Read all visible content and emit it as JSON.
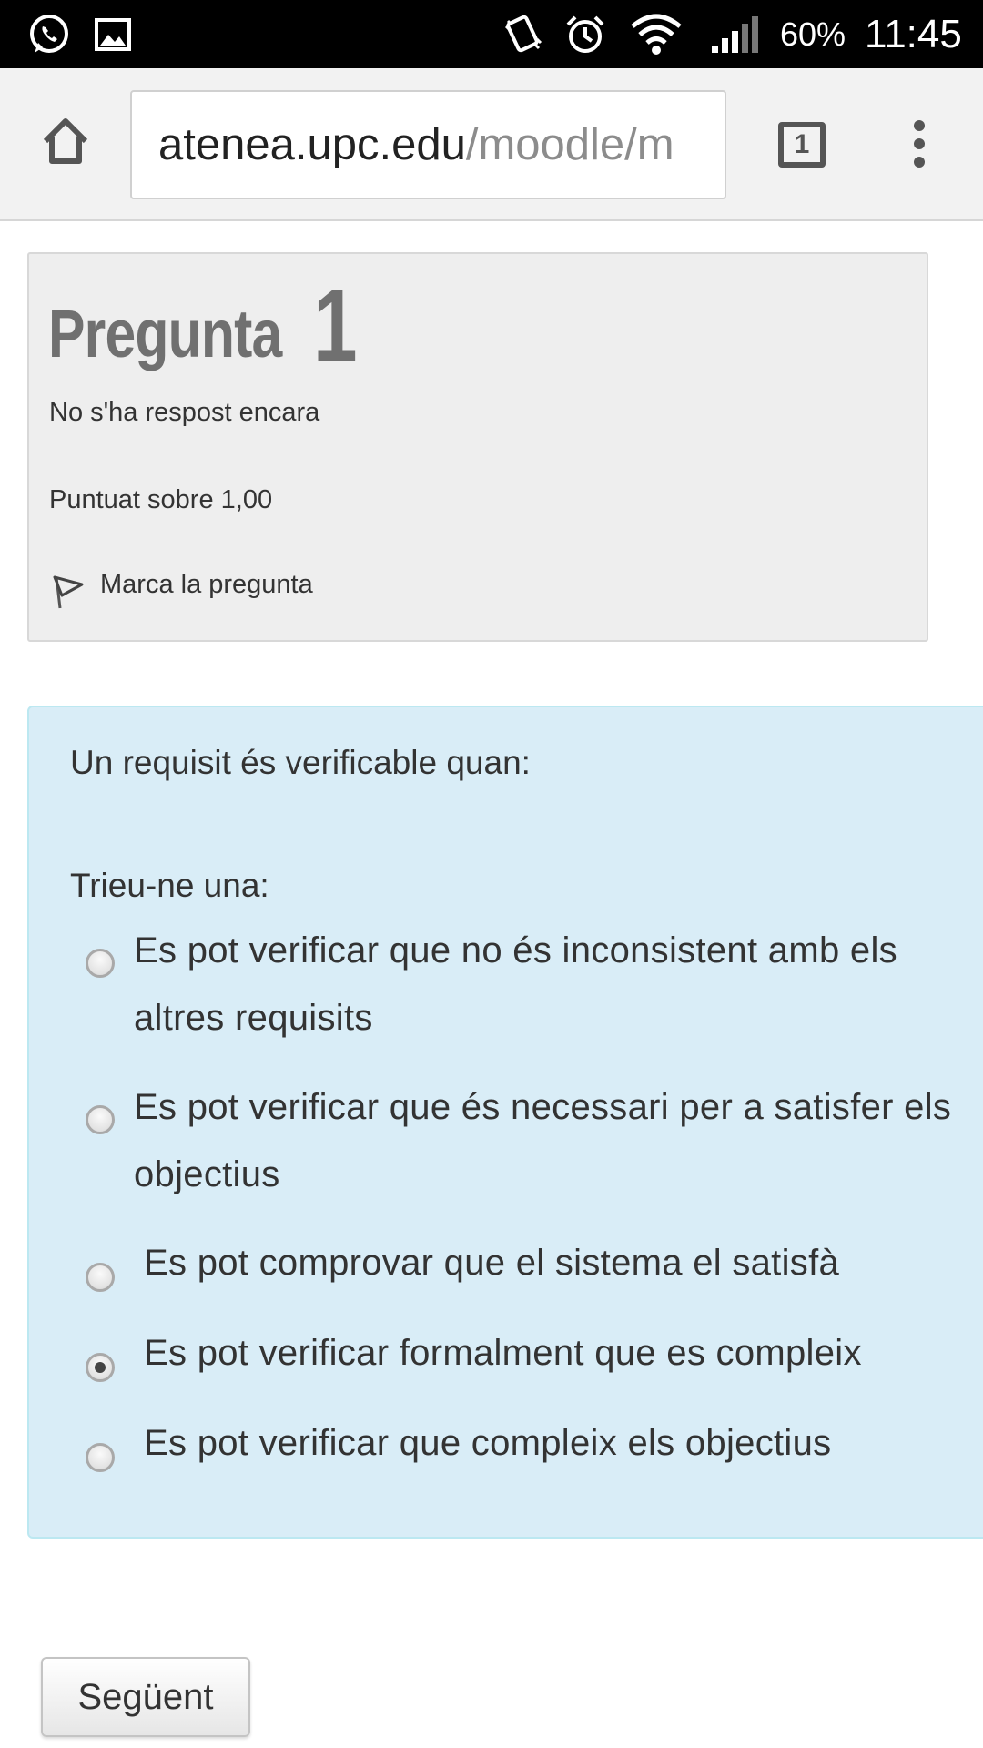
{
  "status_bar": {
    "battery": "60%",
    "time": "11:45",
    "icons": [
      "whatsapp-icon",
      "gallery-icon",
      "vibrate-icon",
      "alarm-icon",
      "wifi-icon",
      "signal-icon"
    ]
  },
  "browser": {
    "url_host": "atenea.upc.edu",
    "url_path": "/moodle/m",
    "tab_count": "1",
    "icons": [
      "home-icon",
      "overflow-menu-icon"
    ]
  },
  "question_info": {
    "title_word": "Pregunta",
    "number": "1",
    "state": "No s'ha respost encara",
    "mark": "Puntuat sobre 1,00",
    "flag_label": "Marca la pregunta"
  },
  "question": {
    "prompt": "Un requisit és verificable quan:",
    "instruction": "Trieu-ne una:",
    "options": [
      {
        "label": "Es pot verificar que no és inconsistent amb els altres requisits",
        "selected": false
      },
      {
        "label": "Es pot verificar que és necessari per a satisfer els objectius",
        "selected": false
      },
      {
        "label": "Es pot comprovar que el sistema el satisfà",
        "selected": false
      },
      {
        "label": "Es pot verificar formalment que es compleix",
        "selected": true
      },
      {
        "label": "Es pot verificar que compleix els objectius",
        "selected": false
      }
    ]
  },
  "navigation": {
    "next_label": "Següent"
  },
  "colors": {
    "status_bar": "#000000",
    "toolbar": "#f2f2f2",
    "info_box": "#eeeeee",
    "question_box": "#d9edf7",
    "question_border": "#bce8f1"
  }
}
